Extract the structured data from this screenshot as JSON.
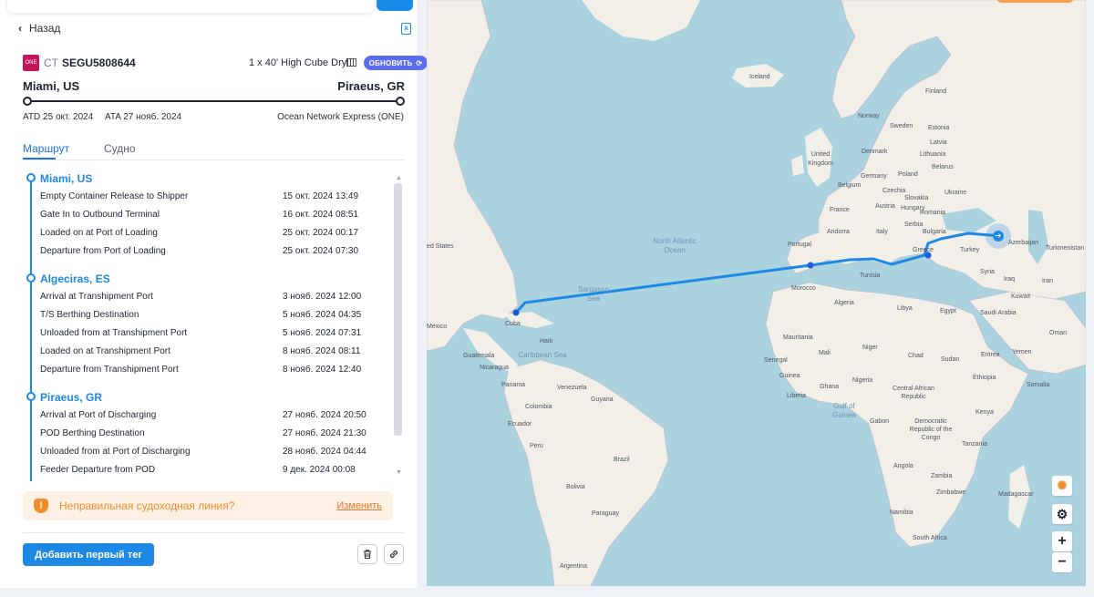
{
  "nav": {
    "back_label": "Назад"
  },
  "shipment": {
    "carrier_logo_text": "ONE",
    "type_label": "CT",
    "container_number": "SEGU5808644",
    "container_type": "1 x 40' High Cube Dry",
    "refresh_label": "ОБНОВИТЬ",
    "pol": "Miami, US",
    "pod": "Piraeus, GR",
    "atd": "ATD 25 окт. 2024",
    "ata": "ATA 27 нояб. 2024",
    "shipping_line": "Ocean Network Express (ONE)"
  },
  "tabs": {
    "route": "Маршрут",
    "vessel": "Судно"
  },
  "timeline": {
    "stops": [
      {
        "name": "Miami, US",
        "events": [
          {
            "name": "Empty Container Release to Shipper",
            "date": "15 окт. 2024 13:49"
          },
          {
            "name": "Gate In to Outbound Terminal",
            "date": "16 окт. 2024 08:51"
          },
          {
            "name": "Loaded on at Port of Loading",
            "date": "25 окт. 2024 00:17"
          },
          {
            "name": "Departure from Port of Loading",
            "date": "25 окт. 2024 07:30"
          }
        ]
      },
      {
        "name": "Algeciras, ES",
        "events": [
          {
            "name": "Arrival at Transhipment Port",
            "date": "3 нояб. 2024 12:00"
          },
          {
            "name": "T/S Berthing Destination",
            "date": "5 нояб. 2024 04:35"
          },
          {
            "name": "Unloaded from at Transhipment Port",
            "date": "5 нояб. 2024 07:31"
          },
          {
            "name": "Loaded on at Transhipment Port",
            "date": "8 нояб. 2024 08:11"
          },
          {
            "name": "Departure from Transhipment Port",
            "date": "8 нояб. 2024 12:40"
          }
        ]
      },
      {
        "name": "Piraeus, GR",
        "events": [
          {
            "name": "Arrival at Port of Discharging",
            "date": "27 нояб. 2024 20:50"
          },
          {
            "name": "POD Berthing Destination",
            "date": "27 нояб. 2024 21:30"
          },
          {
            "name": "Unloaded from at Port of Discharging",
            "date": "28 нояб. 2024 04:44"
          },
          {
            "name": "Feeder Departure from POD",
            "date": "9 дек. 2024 00:08"
          }
        ]
      }
    ]
  },
  "warning": {
    "text": "Неправильная судоходная линия?",
    "link": "Изменить"
  },
  "actions": {
    "add_tag_label": "Добавить первый тег"
  },
  "map": {
    "labels": {
      "iceland": "Iceland",
      "finland": "Finland",
      "norway": "Norway",
      "sweden": "Sweden",
      "estonia": "Estonia",
      "latvia": "Latvia",
      "lithuania": "Lithuania",
      "denmark": "Denmark",
      "united_kingdom": "United Kingdom",
      "belarus": "Belarus",
      "poland": "Poland",
      "belgium": "Belgium",
      "germany": "Germany",
      "czechia": "Czechia",
      "ukraine": "Ukraine",
      "slovakia": "Slovakia",
      "austria": "Austria",
      "hungary": "Hungary",
      "romania": "Romania",
      "france": "France",
      "andorra": "Andorra",
      "italy": "Italy",
      "serbia": "Serbia",
      "bulgaria": "Bulgaria",
      "portugal": "Portugal",
      "greece": "Greece",
      "turkey": "Turkey",
      "azerbaijan": "Azerbaijan",
      "turkmenistan": "Turkmenistan",
      "syria": "Syria",
      "iraq": "Iraq",
      "iran": "Iran",
      "kuwait": "Kuwait",
      "tunisia": "Tunisia",
      "morocco": "Morocco",
      "algeria": "Algeria",
      "libya": "Libya",
      "egypt": "Egypt",
      "saudi_arabia": "Saudi Arabia",
      "oman": "Oman",
      "yemen": "Yemen",
      "united_states": "ed States",
      "mexico": "Mexico",
      "cuba": "Cuba",
      "haiti": "Haiti",
      "guatemala": "Guatemala",
      "nicaragua": "Nicaragua",
      "panama": "Panama",
      "venezuela": "Venezuela",
      "guyana": "Guyana",
      "colombia": "Colombia",
      "ecuador": "Ecuador",
      "peru": "Peru",
      "brazil": "Brazil",
      "bolivia": "Bolivia",
      "paraguay": "Paraguay",
      "argentina": "Argentina",
      "mauritania": "Mauritania",
      "mali": "Mali",
      "niger": "Niger",
      "chad": "Chad",
      "sudan": "Sudan",
      "eritrea": "Eritrea",
      "senegal": "Senegal",
      "guinea": "Guinea",
      "liberia": "Liberia",
      "ghana": "Ghana",
      "nigeria": "Nigeria",
      "ethiopia": "Ethiopia",
      "somalia": "Somalia",
      "car": "Central African Republic",
      "gabon": "Gabon",
      "drc": "Democratic Republic of the Congo",
      "kenya": "Kenya",
      "tanzania": "Tanzania",
      "angola": "Angola",
      "zambia": "Zambia",
      "zimbabwe": "Zimbabwe",
      "namibia": "Namibia",
      "madagascar": "Madagascar",
      "south_africa": "South Africa"
    },
    "seas": {
      "north_atlantic": "North Atlantic Ocean",
      "sargasso": "Sargasso Sea",
      "caribbean": "Caribbean Sea",
      "gulf_guinea": "Gulf of Guinea"
    },
    "zoom_in": "+",
    "zoom_out": "−"
  },
  "colors": {
    "accent": "#1e88e5",
    "warning": "#f28c28",
    "refresh": "#5b6cf0",
    "water": "#aad3df",
    "land": "#f2efe9"
  }
}
